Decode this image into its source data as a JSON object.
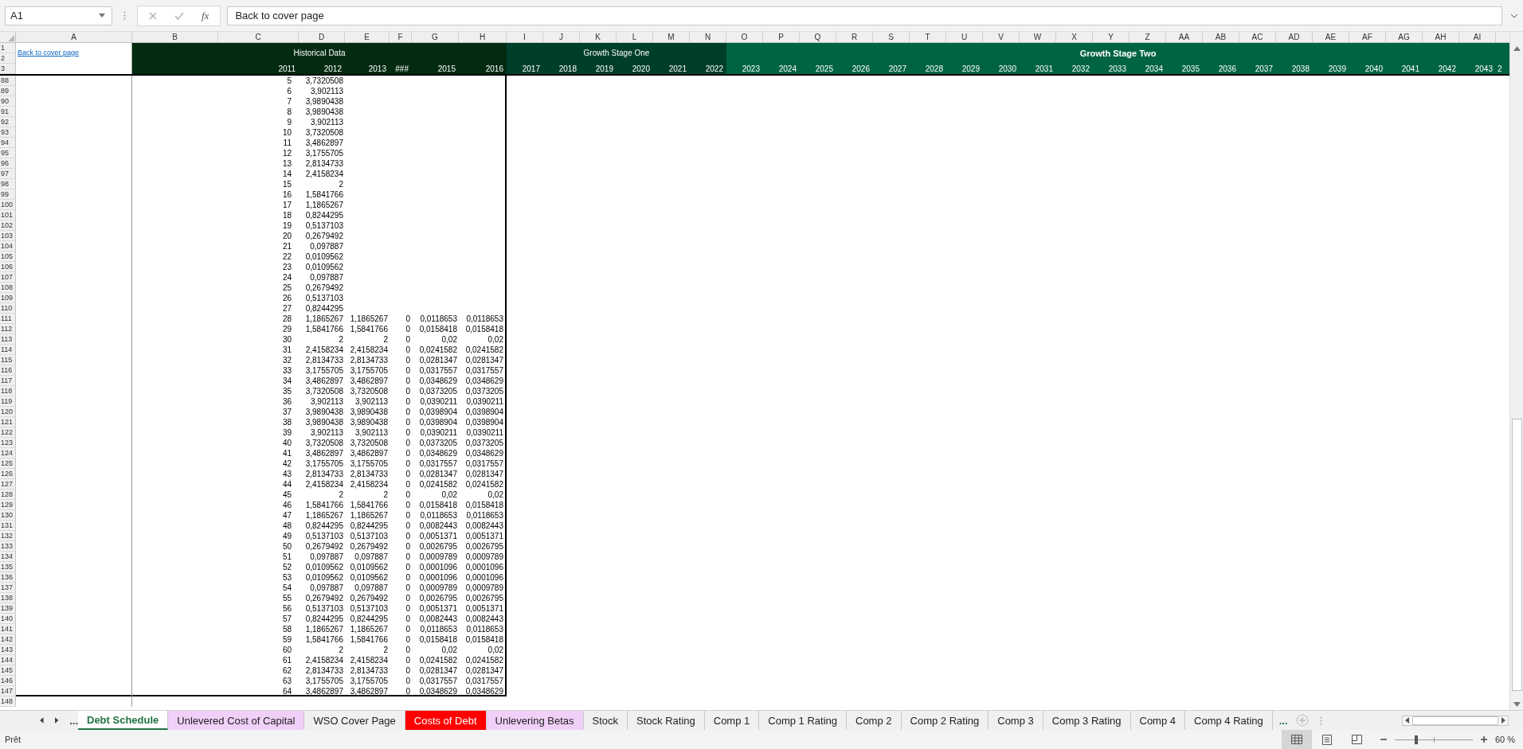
{
  "formula_bar": {
    "name_box": "A1",
    "function_button": "fx",
    "formula": "Back to cover page"
  },
  "columns": [
    "A",
    "B",
    "C",
    "D",
    "E",
    "F",
    "G",
    "H",
    "I",
    "J",
    "K",
    "L",
    "M",
    "N",
    "O",
    "P",
    "Q",
    "R",
    "S",
    "T",
    "U",
    "V",
    "W",
    "X",
    "Y",
    "Z",
    "AA",
    "AB",
    "AC",
    "AD",
    "AE",
    "AF",
    "AG",
    "AH",
    "AI"
  ],
  "sheet": {
    "link": "Back to cover page",
    "header_rows": [
      "1",
      "2",
      "3"
    ],
    "bands": [
      {
        "kind": "historical",
        "title": "Historical Data"
      },
      {
        "kind": "stage_one",
        "title": "Growth Stage One"
      },
      {
        "kind": "stage_two",
        "title": "Growth Stage Two"
      }
    ],
    "years": [
      "2011",
      "2012",
      "2013",
      "###",
      "2015",
      "2016",
      "2017",
      "2018",
      "2019",
      "2020",
      "2021",
      "2022",
      "2023",
      "2024",
      "2025",
      "2026",
      "2027",
      "2028",
      "2029",
      "2030",
      "2031",
      "2032",
      "2033",
      "2034",
      "2035",
      "2036",
      "2037",
      "2038",
      "2039",
      "2040",
      "2041",
      "2042",
      "2043",
      "2"
    ],
    "rows": [
      {
        "number": "88",
        "values": [
          "5",
          "3,7320508"
        ]
      },
      {
        "number": "89",
        "values": [
          "6",
          "3,902113"
        ]
      },
      {
        "number": "90",
        "values": [
          "7",
          "3,9890438"
        ]
      },
      {
        "number": "91",
        "values": [
          "8",
          "3,9890438"
        ]
      },
      {
        "number": "92",
        "values": [
          "9",
          "3,902113"
        ]
      },
      {
        "number": "93",
        "values": [
          "10",
          "3,7320508"
        ]
      },
      {
        "number": "94",
        "values": [
          "11",
          "3,4862897"
        ]
      },
      {
        "number": "95",
        "values": [
          "12",
          "3,1755705"
        ]
      },
      {
        "number": "96",
        "values": [
          "13",
          "2,8134733"
        ]
      },
      {
        "number": "97",
        "values": [
          "14",
          "2,4158234"
        ]
      },
      {
        "number": "98",
        "values": [
          "15",
          "2"
        ]
      },
      {
        "number": "99",
        "values": [
          "16",
          "1,5841766"
        ]
      },
      {
        "number": "100",
        "values": [
          "17",
          "1,1865267"
        ]
      },
      {
        "number": "101",
        "values": [
          "18",
          "0,8244295"
        ]
      },
      {
        "number": "102",
        "values": [
          "19",
          "0,5137103"
        ]
      },
      {
        "number": "103",
        "values": [
          "20",
          "0,2679492"
        ]
      },
      {
        "number": "104",
        "values": [
          "21",
          "0,097887"
        ]
      },
      {
        "number": "105",
        "values": [
          "22",
          "0,0109562"
        ]
      },
      {
        "number": "106",
        "values": [
          "23",
          "0,0109562"
        ]
      },
      {
        "number": "107",
        "values": [
          "24",
          "0,097887"
        ]
      },
      {
        "number": "108",
        "values": [
          "25",
          "0,2679492"
        ]
      },
      {
        "number": "109",
        "values": [
          "26",
          "0,5137103"
        ]
      },
      {
        "number": "110",
        "values": [
          "27",
          "0,8244295"
        ]
      },
      {
        "number": "111",
        "values": [
          "28",
          "1,1865267",
          "1,1865267",
          "0",
          "0,0118653",
          "0,0118653"
        ]
      },
      {
        "number": "112",
        "values": [
          "29",
          "1,5841766",
          "1,5841766",
          "0",
          "0,0158418",
          "0,0158418"
        ]
      },
      {
        "number": "113",
        "values": [
          "30",
          "2",
          "2",
          "0",
          "0,02",
          "0,02"
        ]
      },
      {
        "number": "114",
        "values": [
          "31",
          "2,4158234",
          "2,4158234",
          "0",
          "0,0241582",
          "0,0241582"
        ]
      },
      {
        "number": "115",
        "values": [
          "32",
          "2,8134733",
          "2,8134733",
          "0",
          "0,0281347",
          "0,0281347"
        ]
      },
      {
        "number": "116",
        "values": [
          "33",
          "3,1755705",
          "3,1755705",
          "0",
          "0,0317557",
          "0,0317557"
        ]
      },
      {
        "number": "117",
        "values": [
          "34",
          "3,4862897",
          "3,4862897",
          "0",
          "0,0348629",
          "0,0348629"
        ]
      },
      {
        "number": "118",
        "values": [
          "35",
          "3,7320508",
          "3,7320508",
          "0",
          "0,0373205",
          "0,0373205"
        ]
      },
      {
        "number": "119",
        "values": [
          "36",
          "3,902113",
          "3,902113",
          "0",
          "0,0390211",
          "0,0390211"
        ]
      },
      {
        "number": "120",
        "values": [
          "37",
          "3,9890438",
          "3,9890438",
          "0",
          "0,0398904",
          "0,0398904"
        ]
      },
      {
        "number": "121",
        "values": [
          "38",
          "3,9890438",
          "3,9890438",
          "0",
          "0,0398904",
          "0,0398904"
        ]
      },
      {
        "number": "122",
        "values": [
          "39",
          "3,902113",
          "3,902113",
          "0",
          "0,0390211",
          "0,0390211"
        ]
      },
      {
        "number": "123",
        "values": [
          "40",
          "3,7320508",
          "3,7320508",
          "0",
          "0,0373205",
          "0,0373205"
        ]
      },
      {
        "number": "124",
        "values": [
          "41",
          "3,4862897",
          "3,4862897",
          "0",
          "0,0348629",
          "0,0348629"
        ]
      },
      {
        "number": "125",
        "values": [
          "42",
          "3,1755705",
          "3,1755705",
          "0",
          "0,0317557",
          "0,0317557"
        ]
      },
      {
        "number": "126",
        "values": [
          "43",
          "2,8134733",
          "2,8134733",
          "0",
          "0,0281347",
          "0,0281347"
        ]
      },
      {
        "number": "127",
        "values": [
          "44",
          "2,4158234",
          "2,4158234",
          "0",
          "0,0241582",
          "0,0241582"
        ]
      },
      {
        "number": "128",
        "values": [
          "45",
          "2",
          "2",
          "0",
          "0,02",
          "0,02"
        ]
      },
      {
        "number": "129",
        "values": [
          "46",
          "1,5841766",
          "1,5841766",
          "0",
          "0,0158418",
          "0,0158418"
        ]
      },
      {
        "number": "130",
        "values": [
          "47",
          "1,1865267",
          "1,1865267",
          "0",
          "0,0118653",
          "0,0118653"
        ]
      },
      {
        "number": "131",
        "values": [
          "48",
          "0,8244295",
          "0,8244295",
          "0",
          "0,0082443",
          "0,0082443"
        ]
      },
      {
        "number": "132",
        "values": [
          "49",
          "0,5137103",
          "0,5137103",
          "0",
          "0,0051371",
          "0,0051371"
        ]
      },
      {
        "number": "133",
        "values": [
          "50",
          "0,2679492",
          "0,2679492",
          "0",
          "0,0026795",
          "0,0026795"
        ]
      },
      {
        "number": "134",
        "values": [
          "51",
          "0,097887",
          "0,097887",
          "0",
          "0,0009789",
          "0,0009789"
        ]
      },
      {
        "number": "135",
        "values": [
          "52",
          "0,0109562",
          "0,0109562",
          "0",
          "0,0001096",
          "0,0001096"
        ]
      },
      {
        "number": "136",
        "values": [
          "53",
          "0,0109562",
          "0,0109562",
          "0",
          "0,0001096",
          "0,0001096"
        ]
      },
      {
        "number": "137",
        "values": [
          "54",
          "0,097887",
          "0,097887",
          "0",
          "0,0009789",
          "0,0009789"
        ]
      },
      {
        "number": "138",
        "values": [
          "55",
          "0,2679492",
          "0,2679492",
          "0",
          "0,0026795",
          "0,0026795"
        ]
      },
      {
        "number": "139",
        "values": [
          "56",
          "0,5137103",
          "0,5137103",
          "0",
          "0,0051371",
          "0,0051371"
        ]
      },
      {
        "number": "140",
        "values": [
          "57",
          "0,8244295",
          "0,8244295",
          "0",
          "0,0082443",
          "0,0082443"
        ]
      },
      {
        "number": "141",
        "values": [
          "58",
          "1,1865267",
          "1,1865267",
          "0",
          "0,0118653",
          "0,0118653"
        ]
      },
      {
        "number": "142",
        "values": [
          "59",
          "1,5841766",
          "1,5841766",
          "0",
          "0,0158418",
          "0,0158418"
        ]
      },
      {
        "number": "143",
        "values": [
          "60",
          "2",
          "2",
          "0",
          "0,02",
          "0,02"
        ]
      },
      {
        "number": "144",
        "values": [
          "61",
          "2,4158234",
          "2,4158234",
          "0",
          "0,0241582",
          "0,0241582"
        ]
      },
      {
        "number": "145",
        "values": [
          "62",
          "2,8134733",
          "2,8134733",
          "0",
          "0,0281347",
          "0,0281347"
        ]
      },
      {
        "number": "146",
        "values": [
          "63",
          "3,1755705",
          "3,1755705",
          "0",
          "0,0317557",
          "0,0317557"
        ]
      },
      {
        "number": "147",
        "values": [
          "64",
          "3,4862897",
          "3,4862897",
          "0",
          "0,0348629",
          "0,0348629"
        ]
      },
      {
        "number": "148"
      }
    ]
  },
  "tab_bar": {
    "more_left": "...",
    "more_right": "..."
  },
  "tabs": [
    {
      "label": "Debt Schedule",
      "selected": true
    },
    {
      "label": "Unlevered Cost of Capital",
      "selected": false,
      "color": "#f0d0f8"
    },
    {
      "label": "WSO Cover Page",
      "selected": false
    },
    {
      "label": "Costs of Debt",
      "selected": false,
      "color": "#ff0000"
    },
    {
      "label": "Unlevering Betas",
      "selected": false,
      "color": "#f0d0f8"
    },
    {
      "label": "Stock",
      "selected": false
    },
    {
      "label": "Stock Rating",
      "selected": false
    },
    {
      "label": "Comp 1",
      "selected": false
    },
    {
      "label": "Comp 1 Rating",
      "selected": false
    },
    {
      "label": "Comp 2",
      "selected": false
    },
    {
      "label": "Comp 2 Rating",
      "selected": false
    },
    {
      "label": "Comp 3",
      "selected": false
    },
    {
      "label": "Comp 3 Rating",
      "selected": false
    },
    {
      "label": "Comp 4",
      "selected": false
    },
    {
      "label": "Comp 4 Rating",
      "selected": false
    }
  ],
  "status_bar": {
    "status": "Prêt",
    "views": [
      {
        "kind": "normal",
        "selected": true
      },
      {
        "kind": "page_layout",
        "selected": false
      },
      {
        "kind": "page_break",
        "selected": false
      }
    ],
    "zoom": {
      "level": 0.28,
      "reading": "60 %"
    }
  }
}
